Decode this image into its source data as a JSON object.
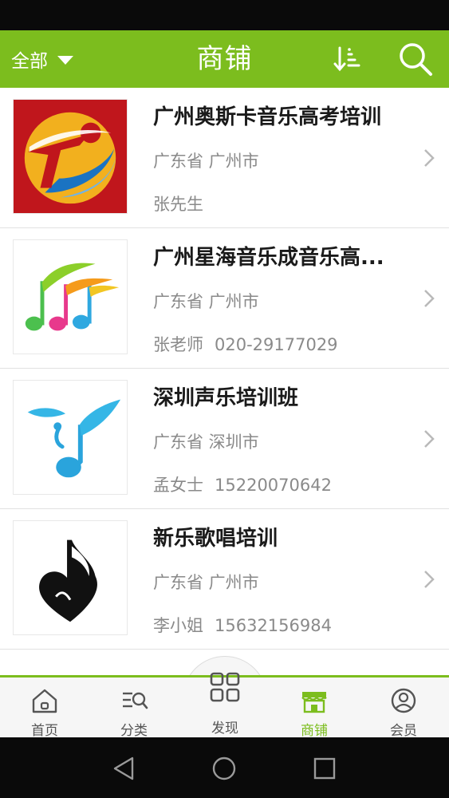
{
  "header": {
    "filter_label": "全部",
    "title": "商铺"
  },
  "shops": [
    {
      "name": "广州奥斯卡音乐高考培训",
      "location": "广东省 广州市",
      "contact": "张先生",
      "phone": ""
    },
    {
      "name": "广州星海音乐成音乐高...",
      "location": "广东省 广州市",
      "contact": "张老师",
      "phone": "020-29177029"
    },
    {
      "name": "深圳声乐培训班",
      "location": "广东省 深圳市",
      "contact": "孟女士",
      "phone": "15220070642"
    },
    {
      "name": "新乐歌唱培训",
      "location": "广东省 广州市",
      "contact": "李小姐",
      "phone": "15632156984"
    }
  ],
  "tabs": {
    "home": "首页",
    "category": "分类",
    "discover": "发现",
    "shop": "商铺",
    "member": "会员"
  },
  "colors": {
    "accent": "#7cbd1e",
    "text_primary": "#1a1a1a",
    "text_secondary": "#8a8a8a"
  }
}
